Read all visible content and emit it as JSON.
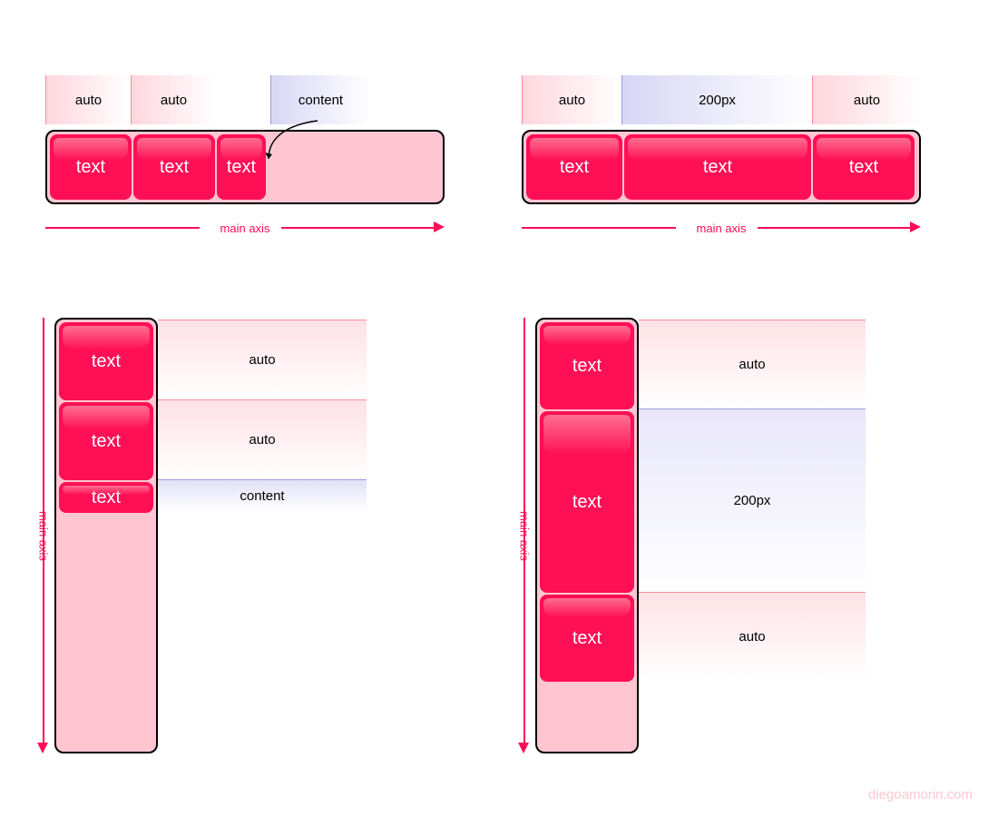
{
  "diagram": {
    "item_text": "text",
    "axis_label": "main axis",
    "q1": {
      "orientation": "row",
      "labels": [
        "auto",
        "auto",
        "content"
      ]
    },
    "q2": {
      "orientation": "row",
      "labels": [
        "auto",
        "200px",
        "auto"
      ]
    },
    "q3": {
      "orientation": "column",
      "labels": [
        "auto",
        "auto",
        "content"
      ]
    },
    "q4": {
      "orientation": "column",
      "labels": [
        "auto",
        "200px",
        "auto"
      ]
    }
  },
  "watermark": "diegoamorin.com",
  "colors": {
    "accent": "#ff0f56",
    "container_bg": "#ffc6d2",
    "blue_label": "#d8d6f5"
  }
}
